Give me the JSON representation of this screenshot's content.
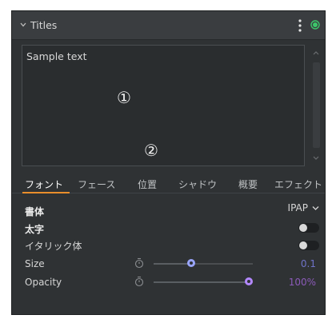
{
  "panel": {
    "title": "Titles",
    "status_color": "#3cc76a",
    "icons": {
      "collapse": "chevron-down-icon",
      "menu": "kebab-menu-icon",
      "status": "status-dot-icon"
    }
  },
  "editor": {
    "text": "Sample text",
    "callouts": [
      "①",
      "②"
    ]
  },
  "tabs": {
    "items": [
      "フォント",
      "フェース",
      "位置",
      "シャドウ",
      "概要",
      "エフェクト"
    ],
    "active_index": 0,
    "accent_color": "#e98e2c"
  },
  "properties": {
    "font_label": "書体",
    "font_value": "IPAP",
    "bold_label": "太字",
    "bold_on": false,
    "italic_label": "イタリック体",
    "italic_on": false,
    "size_label": "Size",
    "size_value": "0.1",
    "size_level": 0.37,
    "opacity_label": "Opacity",
    "opacity_value": "100%",
    "opacity_level": 1.0
  },
  "colors": {
    "size_value": "#6f73c8",
    "opacity_value": "#8b5ab8",
    "size_handle": "#9aa6ff",
    "opacity_handle": "#b388ff"
  }
}
